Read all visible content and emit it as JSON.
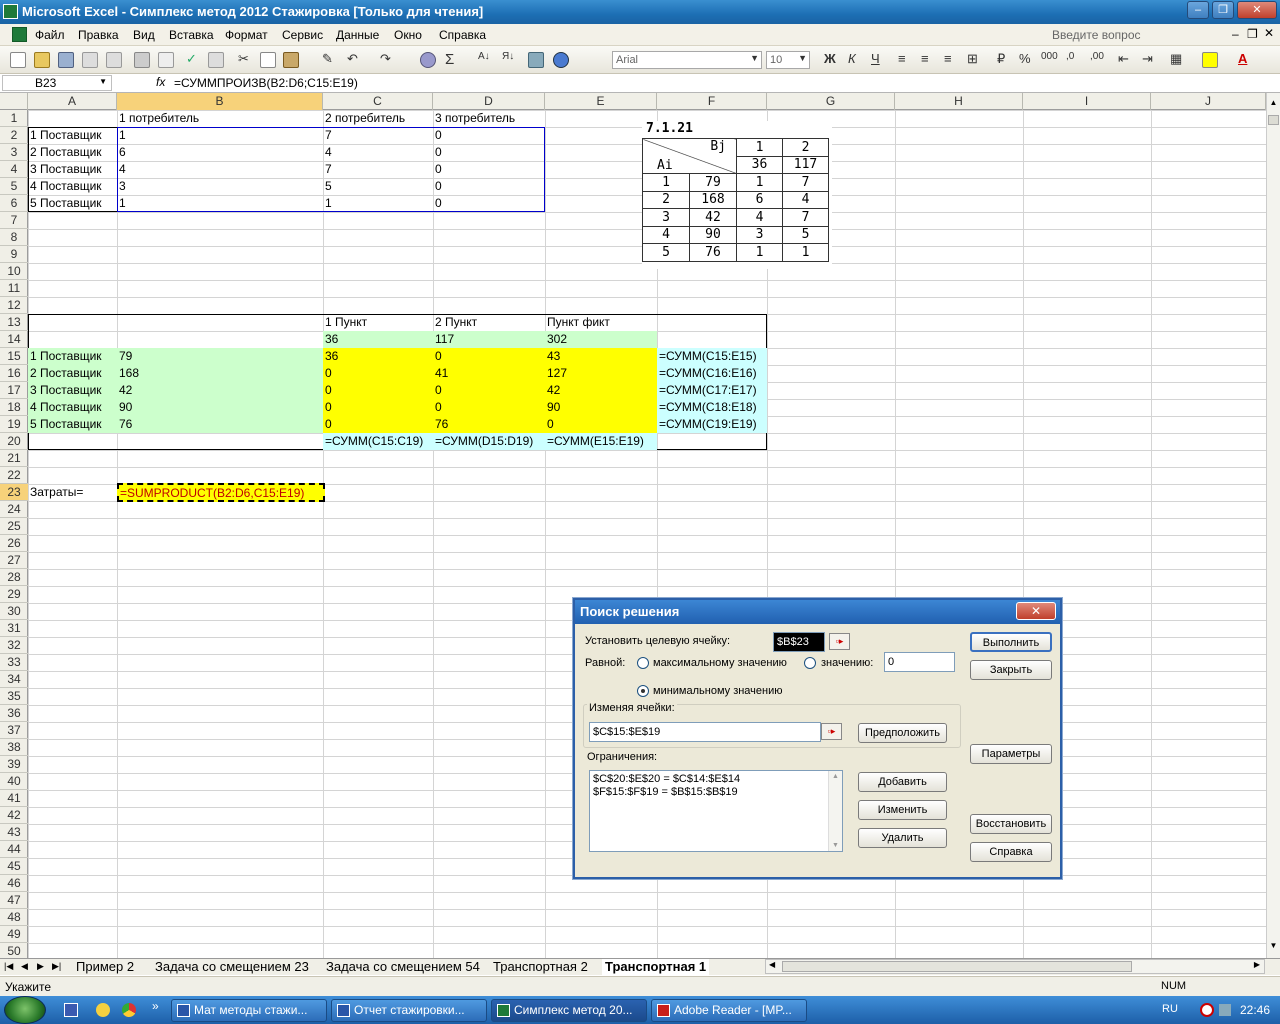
{
  "window": {
    "title": "Microsoft Excel - Симплекс метод 2012 Стажировка  [Только для чтения]"
  },
  "menu": [
    "Файл",
    "Правка",
    "Вид",
    "Вставка",
    "Формат",
    "Сервис",
    "Данные",
    "Окно",
    "Справка"
  ],
  "help_placeholder": "Введите вопрос",
  "toolbar": {
    "font": "Arial",
    "size": "10",
    "bold": "Ж",
    "italic": "К",
    "underline": "Ч"
  },
  "formula": {
    "cell_ref": "B23",
    "fx": "fx",
    "text": "=СУММПРОИЗВ(B2:D6;C15:E19)"
  },
  "columns": [
    "A",
    "B",
    "C",
    "D",
    "E",
    "F",
    "G",
    "H",
    "I",
    "J"
  ],
  "rows": [
    "1",
    "2",
    "3",
    "4",
    "5",
    "6",
    "7",
    "8",
    "9",
    "10",
    "11",
    "12",
    "13",
    "14",
    "15",
    "16",
    "17",
    "18",
    "19",
    "20",
    "21",
    "22",
    "23",
    "24",
    "25",
    "26",
    "27",
    "28",
    "29",
    "30",
    "31",
    "32",
    "33",
    "34",
    "35",
    "36",
    "37",
    "38",
    "39",
    "40",
    "41",
    "42",
    "43",
    "44",
    "45",
    "46",
    "47",
    "48",
    "49",
    "50"
  ],
  "cells": {
    "B1": "1 потребитель",
    "C1": "2 потребитель",
    "D1": "3 потребитель",
    "A2": "1 Поставщик",
    "B2": "1",
    "C2": "7",
    "D2": "0",
    "A3": "2 Поставщик",
    "B3": "6",
    "C3": "4",
    "D3": "0",
    "A4": "3 Поставщик",
    "B4": "4",
    "C4": "7",
    "D4": "0",
    "A5": "4 Поставщик",
    "B5": "3",
    "C5": "5",
    "D5": "0",
    "A6": "5 Поставщик",
    "B6": "1",
    "C6": "1",
    "D6": "0",
    "C13": "1 Пункт",
    "D13": "2 Пункт",
    "E13": "Пункт фикт",
    "C14": "36",
    "D14": "117",
    "E14": "302",
    "A15": "1 Поставщик",
    "B15": "79",
    "C15": "36",
    "D15": "0",
    "E15": "43",
    "F15": "=СУММ(C15:E15)",
    "A16": "2 Поставщик",
    "B16": "168",
    "C16": "0",
    "D16": "41",
    "E16": "127",
    "F16": "=СУММ(C16:E16)",
    "A17": "3 Поставщик",
    "B17": "42",
    "C17": "0",
    "D17": "0",
    "E17": "42",
    "F17": "=СУММ(C17:E17)",
    "A18": "4 Поставщик",
    "B18": "90",
    "C18": "0",
    "D18": "0",
    "E18": "90",
    "F18": "=СУММ(C18:E18)",
    "A19": "5 Поставщик",
    "B19": "76",
    "C19": "0",
    "D19": "76",
    "E19": "0",
    "F19": "=СУММ(C19:E19)",
    "C20": "=СУММ(C15:C19)",
    "D20": "=СУММ(D15:D19)",
    "E20": "=СУММ(E15:E19)",
    "A23": "Затраты=",
    "B23": "=SUMPRODUCT(B2:D6,C15:E19)"
  },
  "image_table": {
    "caption": "7.1.21",
    "head": {
      "b": "Bj",
      "a": "Ai",
      "c1": "1",
      "c2": "2",
      "d1": "36",
      "d2": "117"
    },
    "rows": [
      [
        "1",
        "79",
        "1",
        "7"
      ],
      [
        "2",
        "168",
        "6",
        "4"
      ],
      [
        "3",
        "42",
        "4",
        "7"
      ],
      [
        "4",
        "90",
        "3",
        "5"
      ],
      [
        "5",
        "76",
        "1",
        "1"
      ]
    ]
  },
  "sheet_tabs": [
    "Пример 2",
    "Задача со смещением 23",
    "Задача со смещением 54",
    "Транспортная 2",
    "Транспортная 1"
  ],
  "status": {
    "left": "Укажите",
    "num": "NUM"
  },
  "taskbar": {
    "items": [
      "Мат методы стажи...",
      "Отчет стажировки...",
      "Симплекс метод 20...",
      "Adobe Reader - [MP..."
    ],
    "lang": "RU",
    "time": "22:46"
  },
  "dialog": {
    "title": "Поиск решения",
    "target_label": "Установить целевую ячейку:",
    "target_value": "$B$23",
    "equal_label": "Равной:",
    "opt_max": "максимальному значению",
    "opt_val": "значению:",
    "val_value": "0",
    "opt_min": "минимальному значению",
    "changing_label": "Изменяя ячейки:",
    "changing_value": "$C$15:$E$19",
    "constraints_label": "Ограничения:",
    "constraints": [
      "$C$20:$E$20 = $C$14:$E$14",
      "$F$15:$F$19 = $B$15:$B$19"
    ],
    "btn_run": "Выполнить",
    "btn_close": "Закрыть",
    "btn_guess": "Предположить",
    "btn_options": "Параметры",
    "btn_add": "Добавить",
    "btn_change": "Изменить",
    "btn_delete": "Удалить",
    "btn_reset": "Восстановить",
    "btn_help": "Справка"
  }
}
